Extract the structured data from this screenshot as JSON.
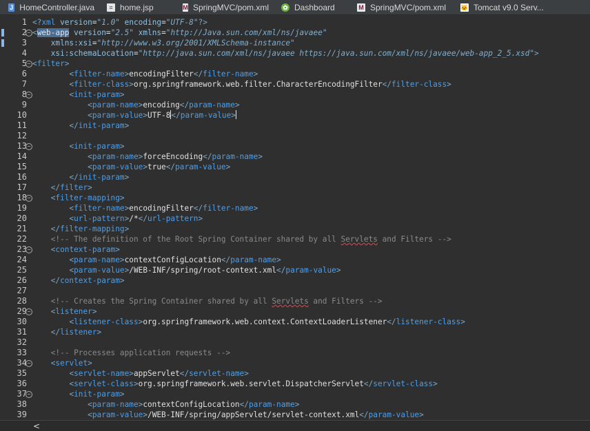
{
  "tabs": [
    {
      "label": "HomeController.java",
      "icon": "java-file-icon",
      "icon_glyph": "J"
    },
    {
      "label": "home.jsp",
      "icon": "jsp-file-icon",
      "icon_glyph": "≡"
    },
    {
      "label": "SpringMVC/pom.xml",
      "icon": "maven-file-icon",
      "icon_glyph": "M"
    },
    {
      "label": "Dashboard",
      "icon": "spring-dashboard-icon",
      "icon_glyph": "✿"
    },
    {
      "label": "SpringMVC/pom.xml",
      "icon": "maven-file-icon",
      "icon_glyph": "M"
    },
    {
      "label": "Tomcat v9.0 Serv...",
      "icon": "tomcat-server-icon",
      "icon_glyph": "🐱"
    }
  ],
  "editor": {
    "folds": {
      "2": "−",
      "5": "−",
      "8": "−",
      "13": "−",
      "18": "−",
      "23": "−",
      "29": "−",
      "34": "−",
      "37": "−"
    },
    "marks": [
      2,
      3
    ],
    "lines": [
      [
        [
          "bracket",
          "<?"
        ],
        [
          "tag",
          "xml"
        ],
        [
          "text",
          " "
        ],
        [
          "attr",
          "version"
        ],
        [
          "text",
          "="
        ],
        [
          "str",
          "\"1.0\""
        ],
        [
          "text",
          " "
        ],
        [
          "attr",
          "encoding"
        ],
        [
          "text",
          "="
        ],
        [
          "str",
          "\"UTF-8\""
        ],
        [
          "bracket",
          "?>"
        ]
      ],
      [
        [
          "bracket",
          "<"
        ],
        [
          "hl",
          "web-app"
        ],
        [
          "text",
          " "
        ],
        [
          "attr",
          "version"
        ],
        [
          "text",
          "="
        ],
        [
          "str",
          "\"2.5\""
        ],
        [
          "text",
          " "
        ],
        [
          "attr",
          "xmlns"
        ],
        [
          "text",
          "="
        ],
        [
          "str",
          "\"http://Java.sun.com/xml/ns/javaee\""
        ]
      ],
      [
        [
          "text",
          "    "
        ],
        [
          "attr",
          "xmlns:xsi"
        ],
        [
          "text",
          "="
        ],
        [
          "str",
          "\"http://www.w3.org/2001/XMLSchema-instance\""
        ]
      ],
      [
        [
          "text",
          "    "
        ],
        [
          "attr",
          "xsi:schemaLocation"
        ],
        [
          "text",
          "="
        ],
        [
          "str",
          "\"http://java.sun.com/xml/ns/javaee https://java.sun.com/xml/ns/javaee/web-app_2_5.xsd\""
        ],
        [
          "bracket",
          ">"
        ]
      ],
      [
        [
          "bracket",
          "<"
        ],
        [
          "tag",
          "filter"
        ],
        [
          "bracket",
          ">"
        ]
      ],
      [
        [
          "text",
          "        "
        ],
        [
          "bracket",
          "<"
        ],
        [
          "tag",
          "filter-name"
        ],
        [
          "bracket",
          ">"
        ],
        [
          "text",
          "encodingFilter"
        ],
        [
          "bracket",
          "</"
        ],
        [
          "tag",
          "filter-name"
        ],
        [
          "bracket",
          ">"
        ]
      ],
      [
        [
          "text",
          "        "
        ],
        [
          "bracket",
          "<"
        ],
        [
          "tag",
          "filter-class"
        ],
        [
          "bracket",
          ">"
        ],
        [
          "text",
          "org.springframework.web.filter.CharacterEncodingFilter"
        ],
        [
          "bracket",
          "</"
        ],
        [
          "tag",
          "filter-class"
        ],
        [
          "bracket",
          ">"
        ]
      ],
      [
        [
          "text",
          "        "
        ],
        [
          "bracket",
          "<"
        ],
        [
          "tag",
          "init-param"
        ],
        [
          "bracket",
          ">"
        ]
      ],
      [
        [
          "text",
          "            "
        ],
        [
          "bracket",
          "<"
        ],
        [
          "tag",
          "param-name"
        ],
        [
          "bracket",
          ">"
        ],
        [
          "text",
          "encoding"
        ],
        [
          "bracket",
          "</"
        ],
        [
          "tag",
          "param-name"
        ],
        [
          "bracket",
          ">"
        ]
      ],
      [
        [
          "text",
          "            "
        ],
        [
          "bracket",
          "<"
        ],
        [
          "tag",
          "param-value"
        ],
        [
          "bracket",
          ">"
        ],
        [
          "text",
          "UTF-8"
        ],
        [
          "caret",
          ""
        ],
        [
          "bracket",
          "</"
        ],
        [
          "tag",
          "param-value"
        ],
        [
          "bracket",
          ">"
        ],
        [
          "caret",
          ""
        ]
      ],
      [
        [
          "text",
          "        "
        ],
        [
          "bracket",
          "</"
        ],
        [
          "tag",
          "init-param"
        ],
        [
          "bracket",
          ">"
        ]
      ],
      [],
      [
        [
          "text",
          "        "
        ],
        [
          "bracket",
          "<"
        ],
        [
          "tag",
          "init-param"
        ],
        [
          "bracket",
          ">"
        ]
      ],
      [
        [
          "text",
          "            "
        ],
        [
          "bracket",
          "<"
        ],
        [
          "tag",
          "param-name"
        ],
        [
          "bracket",
          ">"
        ],
        [
          "text",
          "forceEncoding"
        ],
        [
          "bracket",
          "</"
        ],
        [
          "tag",
          "param-name"
        ],
        [
          "bracket",
          ">"
        ]
      ],
      [
        [
          "text",
          "            "
        ],
        [
          "bracket",
          "<"
        ],
        [
          "tag",
          "param-value"
        ],
        [
          "bracket",
          ">"
        ],
        [
          "text",
          "true"
        ],
        [
          "bracket",
          "</"
        ],
        [
          "tag",
          "param-value"
        ],
        [
          "bracket",
          ">"
        ]
      ],
      [
        [
          "text",
          "        "
        ],
        [
          "bracket",
          "</"
        ],
        [
          "tag",
          "init-param"
        ],
        [
          "bracket",
          ">"
        ]
      ],
      [
        [
          "text",
          "    "
        ],
        [
          "bracket",
          "</"
        ],
        [
          "tag",
          "filter"
        ],
        [
          "bracket",
          ">"
        ]
      ],
      [
        [
          "text",
          "    "
        ],
        [
          "bracket",
          "<"
        ],
        [
          "tag",
          "filter-mapping"
        ],
        [
          "bracket",
          ">"
        ]
      ],
      [
        [
          "text",
          "        "
        ],
        [
          "bracket",
          "<"
        ],
        [
          "tag",
          "filter-name"
        ],
        [
          "bracket",
          ">"
        ],
        [
          "text",
          "encodingFilter"
        ],
        [
          "bracket",
          "</"
        ],
        [
          "tag",
          "filter-name"
        ],
        [
          "bracket",
          ">"
        ]
      ],
      [
        [
          "text",
          "        "
        ],
        [
          "bracket",
          "<"
        ],
        [
          "tag",
          "url-pattern"
        ],
        [
          "bracket",
          ">"
        ],
        [
          "text",
          "/*"
        ],
        [
          "bracket",
          "</"
        ],
        [
          "tag",
          "url-pattern"
        ],
        [
          "bracket",
          ">"
        ]
      ],
      [
        [
          "text",
          "    "
        ],
        [
          "bracket",
          "</"
        ],
        [
          "tag",
          "filter-mapping"
        ],
        [
          "bracket",
          ">"
        ]
      ],
      [
        [
          "text",
          "    "
        ],
        [
          "comment",
          "<!-- The definition of the Root Spring Container shared by all "
        ],
        [
          "commentwarn",
          "Servlets"
        ],
        [
          "comment",
          " and Filters -->"
        ]
      ],
      [
        [
          "text",
          "    "
        ],
        [
          "bracket",
          "<"
        ],
        [
          "tag",
          "context-param"
        ],
        [
          "bracket",
          ">"
        ]
      ],
      [
        [
          "text",
          "        "
        ],
        [
          "bracket",
          "<"
        ],
        [
          "tag",
          "param-name"
        ],
        [
          "bracket",
          ">"
        ],
        [
          "text",
          "contextConfigLocation"
        ],
        [
          "bracket",
          "</"
        ],
        [
          "tag",
          "param-name"
        ],
        [
          "bracket",
          ">"
        ]
      ],
      [
        [
          "text",
          "        "
        ],
        [
          "bracket",
          "<"
        ],
        [
          "tag",
          "param-value"
        ],
        [
          "bracket",
          ">"
        ],
        [
          "text",
          "/WEB-INF/spring/root-context.xml"
        ],
        [
          "bracket",
          "</"
        ],
        [
          "tag",
          "param-value"
        ],
        [
          "bracket",
          ">"
        ]
      ],
      [
        [
          "text",
          "    "
        ],
        [
          "bracket",
          "</"
        ],
        [
          "tag",
          "context-param"
        ],
        [
          "bracket",
          ">"
        ]
      ],
      [],
      [
        [
          "text",
          "    "
        ],
        [
          "comment",
          "<!-- Creates the Spring Container shared by all "
        ],
        [
          "commentwarn",
          "Servlets"
        ],
        [
          "comment",
          " and Filters -->"
        ]
      ],
      [
        [
          "text",
          "    "
        ],
        [
          "bracket",
          "<"
        ],
        [
          "tag",
          "listener"
        ],
        [
          "bracket",
          ">"
        ]
      ],
      [
        [
          "text",
          "        "
        ],
        [
          "bracket",
          "<"
        ],
        [
          "tag",
          "listener-class"
        ],
        [
          "bracket",
          ">"
        ],
        [
          "text",
          "org.springframework.web.context.ContextLoaderListener"
        ],
        [
          "bracket",
          "</"
        ],
        [
          "tag",
          "listener-class"
        ],
        [
          "bracket",
          ">"
        ]
      ],
      [
        [
          "text",
          "    "
        ],
        [
          "bracket",
          "</"
        ],
        [
          "tag",
          "listener"
        ],
        [
          "bracket",
          ">"
        ]
      ],
      [],
      [
        [
          "text",
          "    "
        ],
        [
          "comment",
          "<!-- Processes application requests -->"
        ]
      ],
      [
        [
          "text",
          "    "
        ],
        [
          "bracket",
          "<"
        ],
        [
          "tag",
          "servlet"
        ],
        [
          "bracket",
          ">"
        ]
      ],
      [
        [
          "text",
          "        "
        ],
        [
          "bracket",
          "<"
        ],
        [
          "tag",
          "servlet-name"
        ],
        [
          "bracket",
          ">"
        ],
        [
          "text",
          "appServlet"
        ],
        [
          "bracket",
          "</"
        ],
        [
          "tag",
          "servlet-name"
        ],
        [
          "bracket",
          ">"
        ]
      ],
      [
        [
          "text",
          "        "
        ],
        [
          "bracket",
          "<"
        ],
        [
          "tag",
          "servlet-class"
        ],
        [
          "bracket",
          ">"
        ],
        [
          "text",
          "org.springframework.web.servlet.DispatcherServlet"
        ],
        [
          "bracket",
          "</"
        ],
        [
          "tag",
          "servlet-class"
        ],
        [
          "bracket",
          ">"
        ]
      ],
      [
        [
          "text",
          "        "
        ],
        [
          "bracket",
          "<"
        ],
        [
          "tag",
          "init-param"
        ],
        [
          "bracket",
          ">"
        ]
      ],
      [
        [
          "text",
          "            "
        ],
        [
          "bracket",
          "<"
        ],
        [
          "tag",
          "param-name"
        ],
        [
          "bracket",
          ">"
        ],
        [
          "text",
          "contextConfigLocation"
        ],
        [
          "bracket",
          "</"
        ],
        [
          "tag",
          "param-name"
        ],
        [
          "bracket",
          ">"
        ]
      ],
      [
        [
          "text",
          "            "
        ],
        [
          "bracket",
          "<"
        ],
        [
          "tag",
          "param-value"
        ],
        [
          "bracket",
          ">"
        ],
        [
          "text",
          "/WEB-INF/spring/appServlet/servlet-context.xml"
        ],
        [
          "bracket",
          "</"
        ],
        [
          "tag",
          "param-value"
        ],
        [
          "bracket",
          ">"
        ]
      ]
    ]
  },
  "scrollbar": {
    "left_arrow": "<"
  }
}
